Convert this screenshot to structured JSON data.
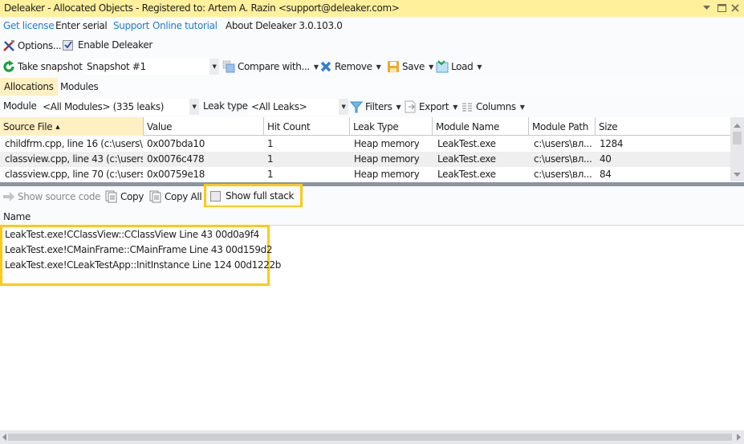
{
  "window": {
    "title": "Deleaker - Allocated Objects - Registered to: Artem A. Razin <support@deleaker.com>",
    "controls": [
      "dropdown",
      "maximize",
      "close"
    ]
  },
  "links": {
    "get_license": "Get license",
    "enter_serial": "Enter serial",
    "support": "Support",
    "online_tutorial": "Online tutorial",
    "about": "About Deleaker 3.0.103.0"
  },
  "toolbar1": {
    "options": "Options...",
    "enable_deleaker": "Enable Deleaker",
    "enable_checked": true
  },
  "toolbar2": {
    "take_snapshot": "Take snapshot",
    "snapshot_value": "Snapshot #1",
    "compare_with": "Compare with...",
    "remove": "Remove",
    "save": "Save",
    "load": "Load"
  },
  "tabs": [
    {
      "label": "Allocations",
      "active": true
    },
    {
      "label": "Modules",
      "active": false
    }
  ],
  "filter_bar": {
    "module_label": "Module",
    "module_value": "<All Modules> (335 leaks)",
    "leak_type_label": "Leak type",
    "leak_type_value": "<All Leaks>",
    "filters": "Filters",
    "export": "Export",
    "columns": "Columns"
  },
  "grid": {
    "columns": [
      "Source File",
      "Value",
      "Hit Count",
      "Leak Type",
      "Module Name",
      "Module Path",
      "Size"
    ],
    "sorted_column": "Source File",
    "sort_direction": "ascending",
    "rows": [
      [
        "childfrm.cpp, line 16 (c:\\users\\...",
        "0x007bda10",
        "1",
        "Heap memory",
        "LeakTest.exe",
        "c:\\users\\вл...",
        "1284"
      ],
      [
        "classview.cpp, line 43 (c:\\users...",
        "0x0076c478",
        "1",
        "Heap memory",
        "LeakTest.exe",
        "c:\\users\\вл...",
        "40"
      ],
      [
        "classview.cpp, line 70 (c:\\users...",
        "0x00759e18",
        "1",
        "Heap memory",
        "LeakTest.exe",
        "c:\\users\\вл...",
        "84"
      ]
    ]
  },
  "stack_toolbar": {
    "show_source_code": "Show source code",
    "copy": "Copy",
    "copy_all": "Copy All",
    "show_full_stack": "Show full stack",
    "show_full_stack_checked": false
  },
  "stack_panel": {
    "header": "Name",
    "lines": [
      "LeakTest.exe!CClassView::CClassView Line 43 00d0a9f4",
      "LeakTest.exe!CMainFrame::CMainFrame Line 43 00d159d2",
      "LeakTest.exe!CLeakTestApp::InitInstance Line 124 00d1222b"
    ]
  },
  "colors": {
    "titlebar": "#fff09c",
    "active_tab": "#fff0c2",
    "link": "#1e7cd1",
    "highlight_box": "#ffc914",
    "splitter": "#8a94a2"
  }
}
